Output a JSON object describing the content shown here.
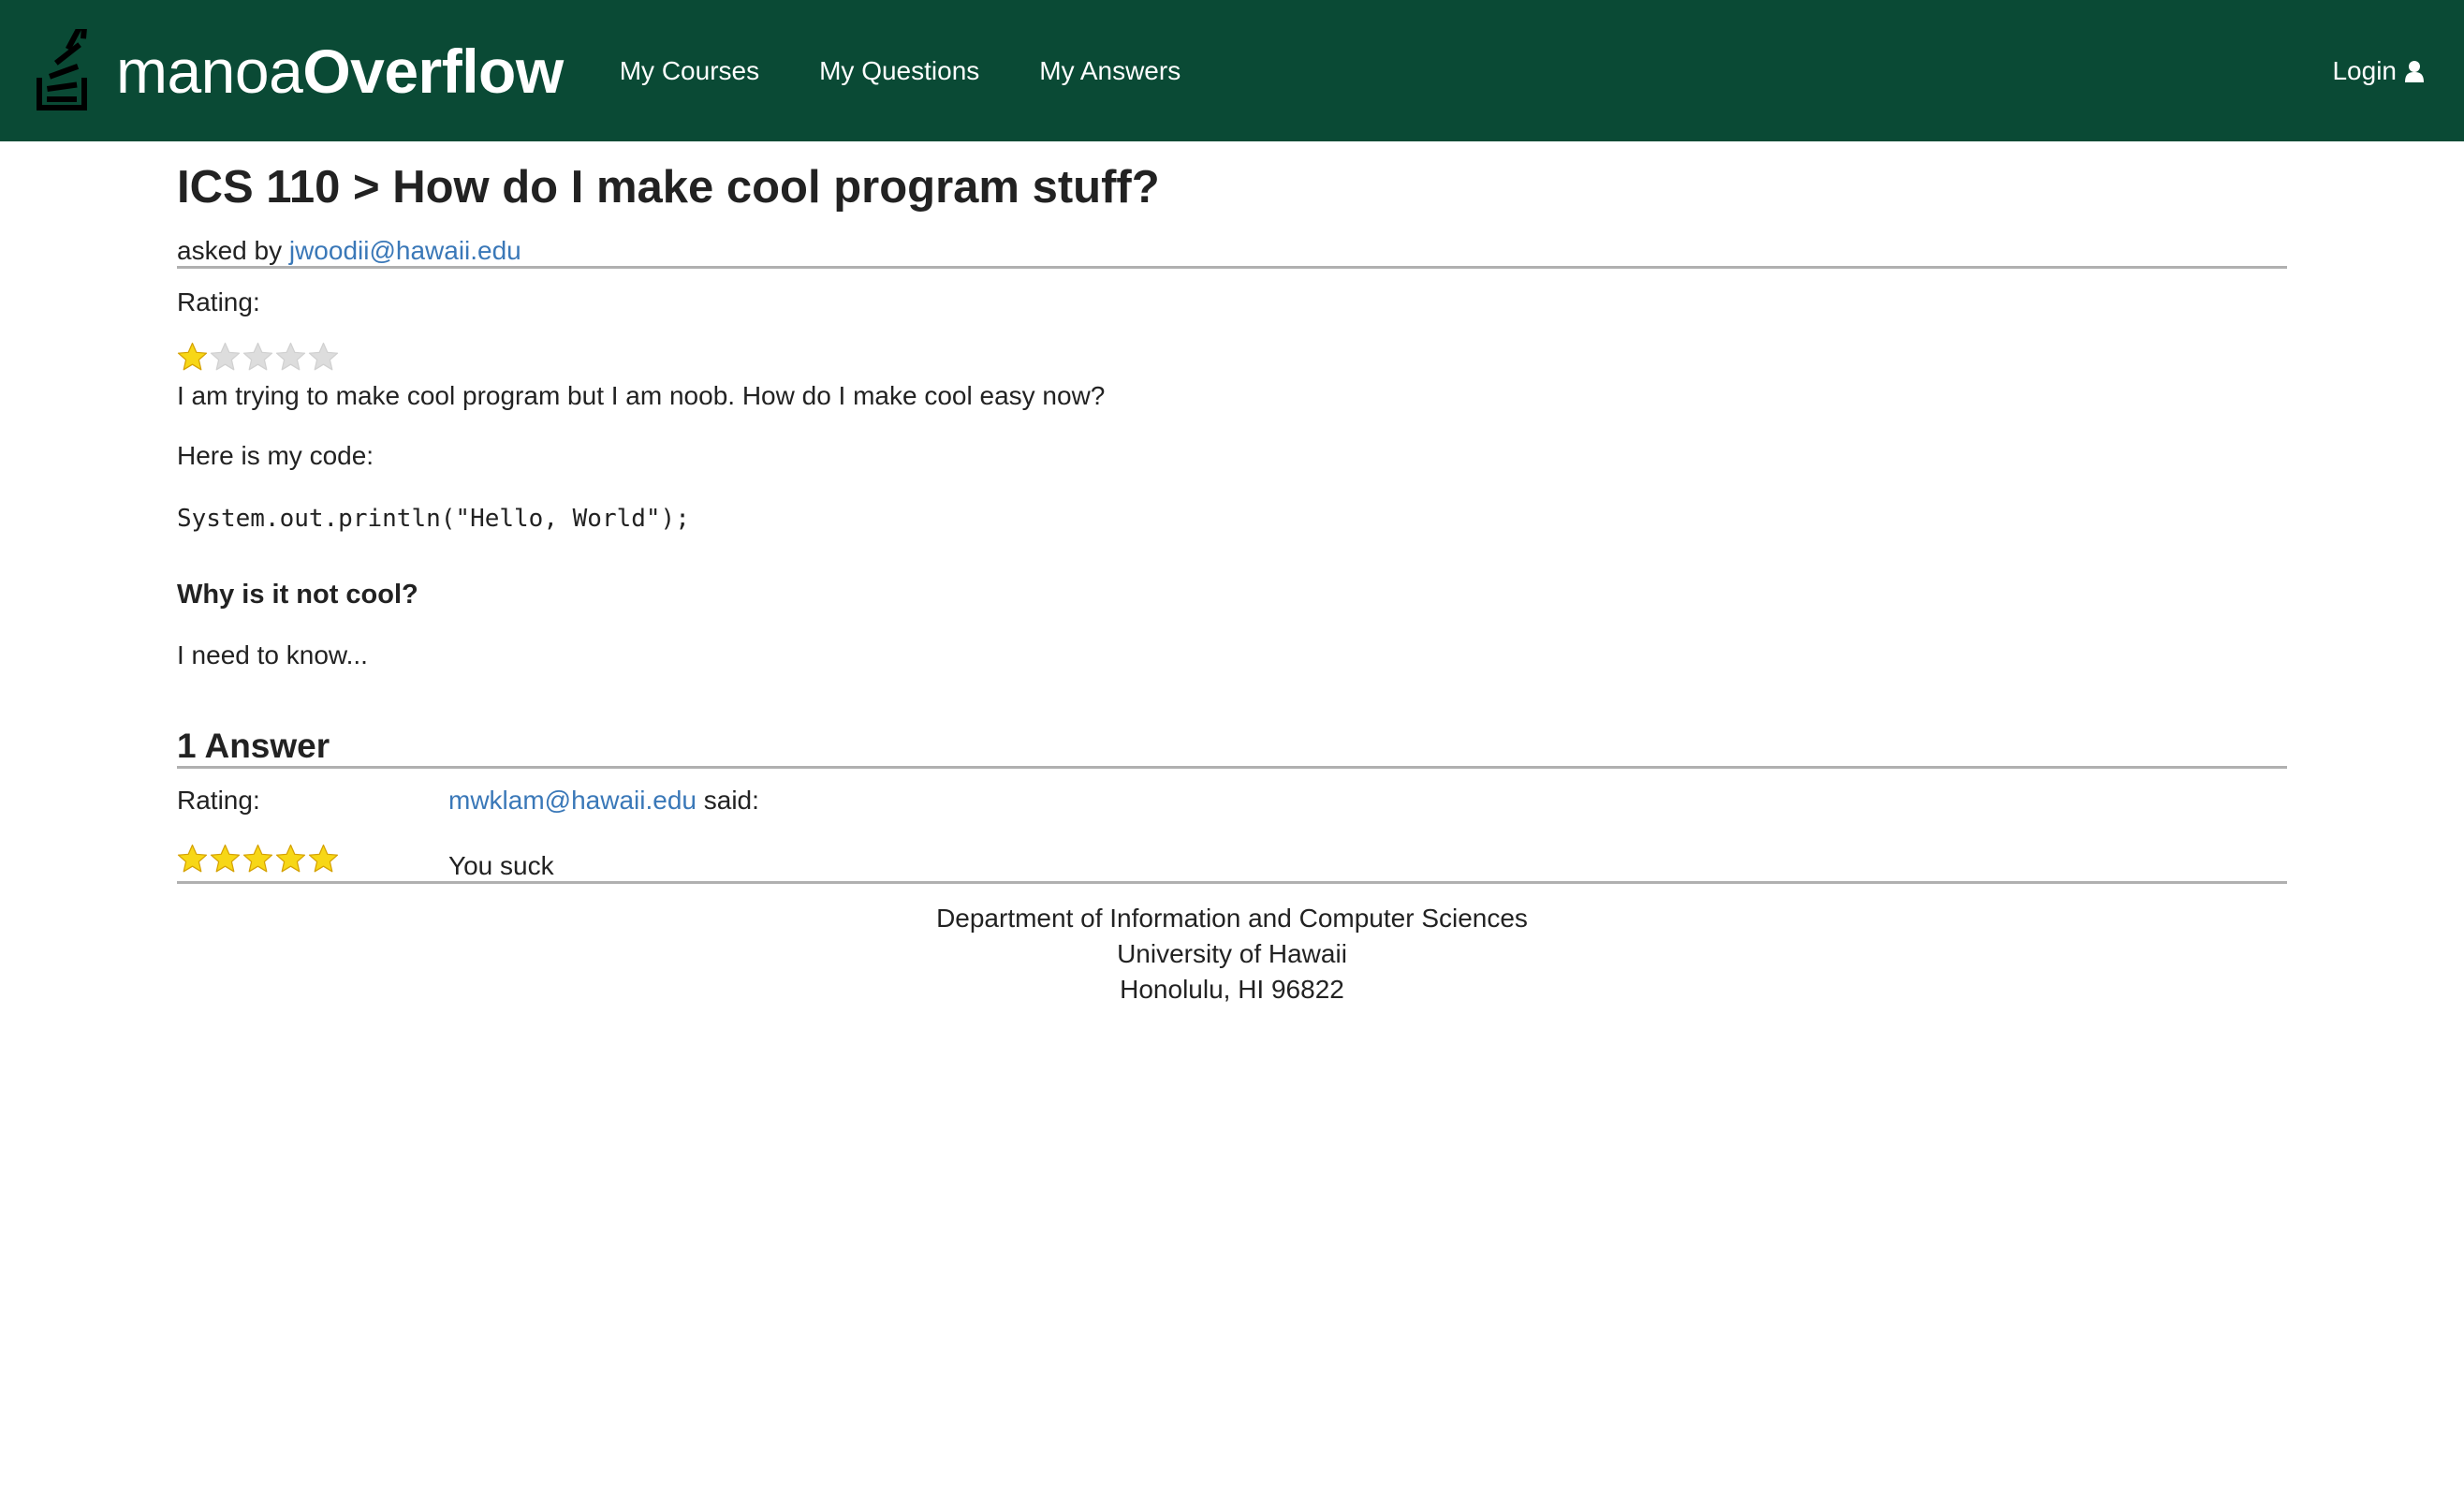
{
  "header": {
    "brand_light": "manoa",
    "brand_bold": "Overflow",
    "nav": [
      {
        "label": "My Courses"
      },
      {
        "label": "My Questions"
      },
      {
        "label": "My Answers"
      }
    ],
    "login_label": "Login",
    "colors": {
      "navbar_bg": "#0a4a35",
      "link": "#3a78b8",
      "star_filled": "#f7d716",
      "star_empty": "#dddddd"
    }
  },
  "question": {
    "title": "ICS 110 > How do I make cool program stuff?",
    "asked_by_prefix": "asked by",
    "author": "jwoodii@hawaii.edu",
    "rating_label": "Rating:",
    "rating": 1,
    "rating_max": 5,
    "body_line": "I am trying to make cool program but I am noob. How do I make cool easy now?",
    "code_intro": "Here is my code:",
    "code": "System.out.println(\"Hello, World\");",
    "subheading": "Why is it not cool?",
    "closing": "I need to know..."
  },
  "answers": {
    "count_label": "1 Answer",
    "items": [
      {
        "rating_label": "Rating:",
        "rating": 5,
        "rating_max": 5,
        "author": "mwklam@hawaii.edu",
        "said": "said:",
        "body": "You suck"
      }
    ]
  },
  "footer": {
    "line1": "Department of Information and Computer Sciences",
    "line2": "University of Hawaii",
    "line3": "Honolulu, HI 96822"
  },
  "icons": {
    "logo": "stack-logo-icon",
    "login": "user-icon",
    "star": "star-icon"
  }
}
